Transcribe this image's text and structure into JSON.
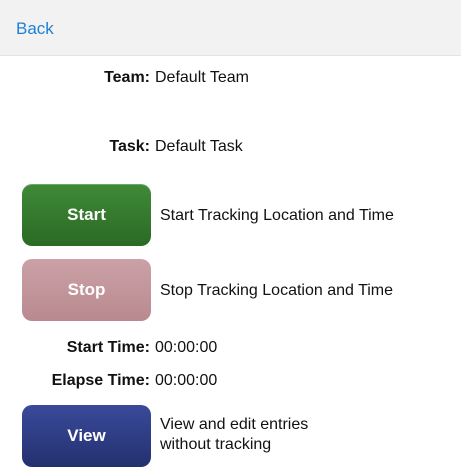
{
  "nav": {
    "back_label": "Back"
  },
  "team": {
    "label": "Team:",
    "value": "Default Team"
  },
  "task": {
    "label": "Task:",
    "value": "Default Task"
  },
  "start": {
    "button_label": "Start",
    "description": "Start Tracking Location and Time",
    "color": "#357a2e"
  },
  "stop": {
    "button_label": "Stop",
    "description": "Stop Tracking Location and Time",
    "color": "#c2959b"
  },
  "start_time": {
    "label": "Start Time:",
    "value": "00:00:00"
  },
  "elapse_time": {
    "label": "Elapse Time:",
    "value": "00:00:00"
  },
  "view": {
    "button_label": "View",
    "description": "View and edit entries\nwithout tracking",
    "color": "#2d3a84"
  },
  "colors": {
    "link": "#1f7fd6",
    "nav_background": "#f2f2f2"
  }
}
